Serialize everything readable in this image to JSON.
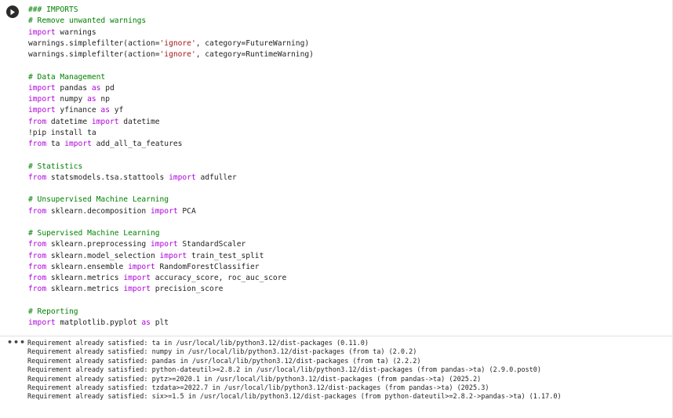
{
  "colors": {
    "keyword": "#af00db",
    "comment": "#008000",
    "string": "#a31515",
    "text": "#1f1f1f",
    "run_button": "#2b2b2b"
  },
  "toolbar": {
    "run_icon": "play-icon",
    "output_menu_icon": "ellipsis-icon",
    "output_menu_label": "•••"
  },
  "code_lines": [
    [
      {
        "c": "cm",
        "t": "### IMPORTS"
      }
    ],
    [
      {
        "c": "cm",
        "t": "# Remove unwanted warnings"
      }
    ],
    [
      {
        "c": "kw",
        "t": "import"
      },
      {
        "c": "df",
        "t": " warnings"
      }
    ],
    [
      {
        "c": "df",
        "t": "warnings.simplefilter(action="
      },
      {
        "c": "st",
        "t": "'ignore'"
      },
      {
        "c": "df",
        "t": ", category=FutureWarning)"
      }
    ],
    [
      {
        "c": "df",
        "t": "warnings.simplefilter(action="
      },
      {
        "c": "st",
        "t": "'ignore'"
      },
      {
        "c": "df",
        "t": ", category=RuntimeWarning)"
      }
    ],
    [],
    [
      {
        "c": "cm",
        "t": "# Data Management"
      }
    ],
    [
      {
        "c": "kw",
        "t": "import"
      },
      {
        "c": "df",
        "t": " pandas "
      },
      {
        "c": "kw",
        "t": "as"
      },
      {
        "c": "df",
        "t": " pd"
      }
    ],
    [
      {
        "c": "kw",
        "t": "import"
      },
      {
        "c": "df",
        "t": " numpy "
      },
      {
        "c": "kw",
        "t": "as"
      },
      {
        "c": "df",
        "t": " np"
      }
    ],
    [
      {
        "c": "kw",
        "t": "import"
      },
      {
        "c": "df",
        "t": " yfinance "
      },
      {
        "c": "kw",
        "t": "as"
      },
      {
        "c": "df",
        "t": " yf"
      }
    ],
    [
      {
        "c": "kw",
        "t": "from"
      },
      {
        "c": "df",
        "t": " datetime "
      },
      {
        "c": "kw",
        "t": "import"
      },
      {
        "c": "df",
        "t": " datetime"
      }
    ],
    [
      {
        "c": "df",
        "t": "!pip install ta"
      }
    ],
    [
      {
        "c": "kw",
        "t": "from"
      },
      {
        "c": "df",
        "t": " ta "
      },
      {
        "c": "kw",
        "t": "import"
      },
      {
        "c": "df",
        "t": " add_all_ta_features"
      }
    ],
    [],
    [
      {
        "c": "cm",
        "t": "# Statistics"
      }
    ],
    [
      {
        "c": "kw",
        "t": "from"
      },
      {
        "c": "df",
        "t": " statsmodels.tsa.stattools "
      },
      {
        "c": "kw",
        "t": "import"
      },
      {
        "c": "df",
        "t": " adfuller"
      }
    ],
    [],
    [
      {
        "c": "cm",
        "t": "# Unsupervised Machine Learning"
      }
    ],
    [
      {
        "c": "kw",
        "t": "from"
      },
      {
        "c": "df",
        "t": " sklearn.decomposition "
      },
      {
        "c": "kw",
        "t": "import"
      },
      {
        "c": "df",
        "t": " PCA"
      }
    ],
    [],
    [
      {
        "c": "cm",
        "t": "# Supervised Machine Learning"
      }
    ],
    [
      {
        "c": "kw",
        "t": "from"
      },
      {
        "c": "df",
        "t": " sklearn.preprocessing "
      },
      {
        "c": "kw",
        "t": "import"
      },
      {
        "c": "df",
        "t": " StandardScaler"
      }
    ],
    [
      {
        "c": "kw",
        "t": "from"
      },
      {
        "c": "df",
        "t": " sklearn.model_selection "
      },
      {
        "c": "kw",
        "t": "import"
      },
      {
        "c": "df",
        "t": " train_test_split"
      }
    ],
    [
      {
        "c": "kw",
        "t": "from"
      },
      {
        "c": "df",
        "t": " sklearn.ensemble "
      },
      {
        "c": "kw",
        "t": "import"
      },
      {
        "c": "df",
        "t": " RandomForestClassifier"
      }
    ],
    [
      {
        "c": "kw",
        "t": "from"
      },
      {
        "c": "df",
        "t": " sklearn.metrics "
      },
      {
        "c": "kw",
        "t": "import"
      },
      {
        "c": "df",
        "t": " accuracy_score, roc_auc_score"
      }
    ],
    [
      {
        "c": "kw",
        "t": "from"
      },
      {
        "c": "df",
        "t": " sklearn.metrics "
      },
      {
        "c": "kw",
        "t": "import"
      },
      {
        "c": "df",
        "t": " precision_score"
      }
    ],
    [],
    [
      {
        "c": "cm",
        "t": "# Reporting"
      }
    ],
    [
      {
        "c": "kw",
        "t": "import"
      },
      {
        "c": "df",
        "t": " matplotlib.pyplot "
      },
      {
        "c": "kw",
        "t": "as"
      },
      {
        "c": "df",
        "t": " plt"
      }
    ]
  ],
  "output_lines": [
    "Requirement already satisfied: ta in /usr/local/lib/python3.12/dist-packages (0.11.0)",
    "Requirement already satisfied: numpy in /usr/local/lib/python3.12/dist-packages (from ta) (2.0.2)",
    "Requirement already satisfied: pandas in /usr/local/lib/python3.12/dist-packages (from ta) (2.2.2)",
    "Requirement already satisfied: python-dateutil>=2.8.2 in /usr/local/lib/python3.12/dist-packages (from pandas->ta) (2.9.0.post0)",
    "Requirement already satisfied: pytz>=2020.1 in /usr/local/lib/python3.12/dist-packages (from pandas->ta) (2025.2)",
    "Requirement already satisfied: tzdata>=2022.7 in /usr/local/lib/python3.12/dist-packages (from pandas->ta) (2025.3)",
    "Requirement already satisfied: six>=1.5 in /usr/local/lib/python3.12/dist-packages (from python-dateutil>=2.8.2->pandas->ta) (1.17.0)"
  ]
}
